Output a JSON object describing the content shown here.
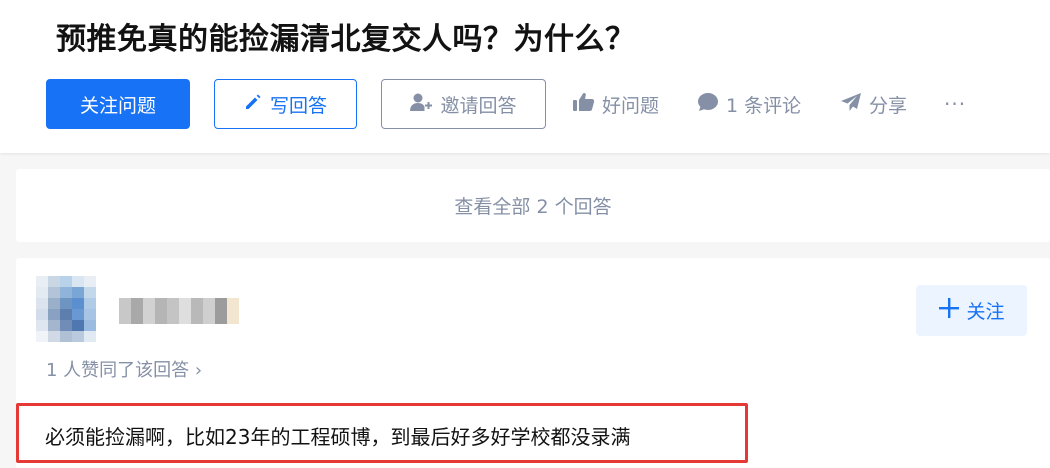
{
  "question": {
    "title": "预推免真的能捡漏清北复交人吗？为什么？"
  },
  "toolbar": {
    "follow_label": "关注问题",
    "write_answer_label": "写回答",
    "invite_label": "邀请回答",
    "good_question_label": "好问题",
    "comment_label": "1 条评论",
    "share_label": "分享",
    "more_label": "···"
  },
  "view_all": {
    "label": "查看全部 2 个回答"
  },
  "answer": {
    "follow_author_label": "关注",
    "voters_label": "1 人赞同了该回答 ›",
    "content": "必须能捡漏啊，比如23年的工程硕博，到最后好多好学校都没录满"
  },
  "colors": {
    "accent": "#1772f6",
    "muted": "#8590a6",
    "highlight_border": "#e53935",
    "follow_bg": "#ebf4ff"
  },
  "icons": {
    "write": "pencil-icon",
    "invite": "add-user-icon",
    "good": "thumbs-up-icon",
    "comment": "comment-bubble-icon",
    "share": "paper-plane-icon",
    "follow": "plus-icon"
  }
}
